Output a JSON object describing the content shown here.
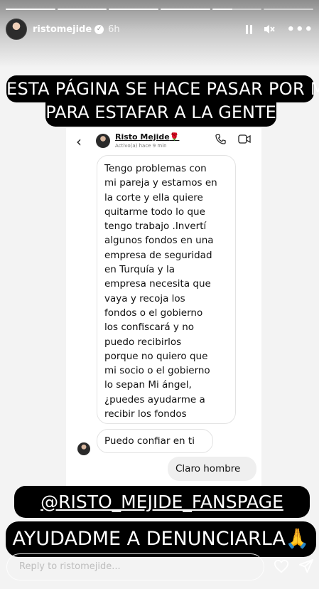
{
  "story": {
    "progress": [
      1,
      1,
      1,
      1,
      0.4,
      0
    ],
    "username": "ristomejide",
    "time": "6h",
    "icons": [
      "pause-icon",
      "mute-icon",
      "more-icon",
      "verified-icon"
    ]
  },
  "banners": {
    "line1": "ESTA PÁGINA SE HACE PASAR POR MÍ",
    "line2": "PARA ESTAFAR A LA GENTE",
    "mention": "@RISTO_MEJIDE_FANSPAGE",
    "help": "AYUDADME A DENUNCIARLA🙏"
  },
  "dm": {
    "name": "Risto Mejide",
    "name_emoji": "🌹",
    "status": "Activo(a) hace 9 min",
    "message_long": "Tengo problemas con\nmi pareja y estamos en\nla corte y ella quiere\nquitarme todo lo que\ntengo trabajo .Invertí\nalgunos fondos en una\nempresa de seguridad\nen Turquía y la\nempresa necesita que\nvaya y recoja los\nfondos o el gobierno\nlos confiscará y no\npuedo recibirlos\nporque no quiero que\nmi socio o el gobierno\nlo sepan Mi ángel,\n¿puedes ayudarme a\nrecibir los fondos",
    "message_trust": "Puedo confiar en ti",
    "message_reply": "Claro hombre"
  },
  "reply_bar": {
    "placeholder": "Reply to ristomejide..."
  },
  "colors": {
    "banner_bg": "#000000",
    "banner_text": "#ffffff",
    "dm_bg": "#ffffff",
    "bubble_sent": "#efefef"
  }
}
